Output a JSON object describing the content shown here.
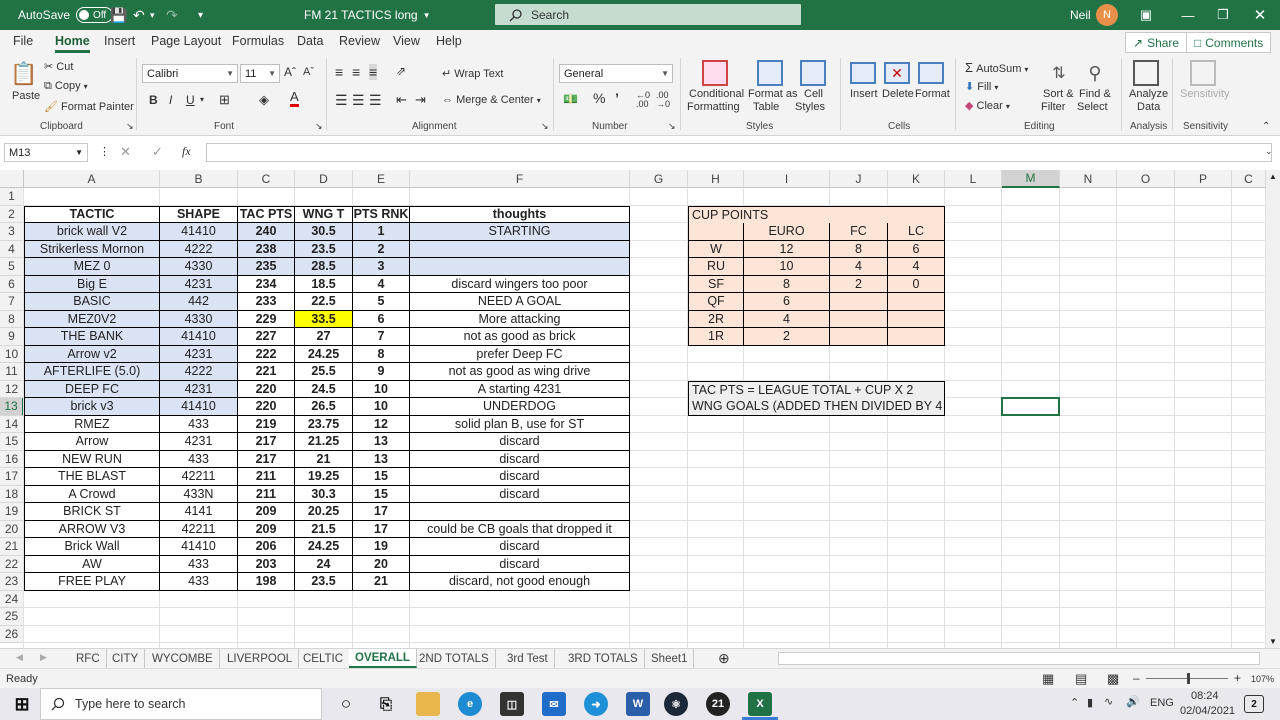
{
  "titlebar": {
    "autosave_label": "AutoSave",
    "autosave_state": "Off",
    "file_title": "FM 21 TACTICS long",
    "search_placeholder": "Search",
    "user_name": "Neil",
    "user_initial": "N"
  },
  "ribbon_tabs": [
    "File",
    "Home",
    "Insert",
    "Page Layout",
    "Formulas",
    "Data",
    "Review",
    "View",
    "Help"
  ],
  "active_tab": "Home",
  "share_label": "Share",
  "comments_label": "Comments",
  "ribbon": {
    "clipboard": {
      "paste": "Paste",
      "cut": "Cut",
      "copy": "Copy",
      "format_painter": "Format Painter",
      "label": "Clipboard"
    },
    "font": {
      "name": "Calibri",
      "size": "11",
      "label": "Font"
    },
    "alignment": {
      "wrap_text": "Wrap Text",
      "merge_center": "Merge & Center",
      "label": "Alignment"
    },
    "number": {
      "format": "General",
      "label": "Number"
    },
    "styles": {
      "conditional_1": "Conditional",
      "conditional_2": "Formatting",
      "format_as_1": "Format as",
      "format_as_2": "Table",
      "cell_1": "Cell",
      "cell_2": "Styles",
      "label": "Styles"
    },
    "cells": {
      "insert": "Insert",
      "delete": "Delete",
      "format": "Format",
      "label": "Cells"
    },
    "editing": {
      "autosum": "AutoSum",
      "fill": "Fill",
      "clear": "Clear",
      "sort_1": "Sort &",
      "sort_2": "Filter",
      "find_1": "Find &",
      "find_2": "Select",
      "label": "Editing"
    },
    "analysis": {
      "analyze_1": "Analyze",
      "analyze_2": "Data",
      "label": "Analysis"
    },
    "sensitivity": {
      "button": "Sensitivity",
      "label": "Sensitivity"
    }
  },
  "formula_bar": {
    "name_box": "M13",
    "fx": "fx",
    "content": ""
  },
  "columns": [
    "A",
    "B",
    "C",
    "D",
    "E",
    "F",
    "G",
    "H",
    "I",
    "J",
    "K",
    "L",
    "M",
    "N",
    "O",
    "P",
    "C"
  ],
  "rows": [
    "1",
    "2",
    "3",
    "4",
    "5",
    "6",
    "7",
    "8",
    "9",
    "10",
    "11",
    "12",
    "13",
    "14",
    "15",
    "16",
    "17",
    "18",
    "19",
    "20",
    "21",
    "22",
    "23",
    "24",
    "25",
    "26"
  ],
  "selected_cell": "M13",
  "main_table": {
    "headers": [
      "TACTIC",
      "SHAPE",
      "TAC PTS",
      "WNG T",
      "PTS RNK",
      "thoughts"
    ],
    "rows": [
      [
        "brick wall V2",
        "41410",
        "240",
        "30.5",
        "1",
        "STARTING"
      ],
      [
        "Strikerless Mornon",
        "4222",
        "238",
        "23.5",
        "2",
        ""
      ],
      [
        "MEZ 0",
        "4330",
        "235",
        "28.5",
        "3",
        ""
      ],
      [
        "Big E",
        "4231",
        "234",
        "18.5",
        "4",
        "discard wingers too poor"
      ],
      [
        "BASIC",
        "442",
        "233",
        "22.5",
        "5",
        "NEED A GOAL"
      ],
      [
        "MEZ0V2",
        "4330",
        "229",
        "33.5",
        "6",
        "More attacking"
      ],
      [
        "THE BANK",
        "41410",
        "227",
        "27",
        "7",
        "not as good as brick"
      ],
      [
        "Arrow v2",
        "4231",
        "222",
        "24.25",
        "8",
        "prefer Deep FC"
      ],
      [
        "AFTERLIFE (5.0)",
        "4222",
        "221",
        "25.5",
        "9",
        "not as good as wing drive"
      ],
      [
        "DEEP FC",
        "4231",
        "220",
        "24.5",
        "10",
        "A starting 4231"
      ],
      [
        "brick v3",
        "41410",
        "220",
        "26.5",
        "10",
        "UNDERDOG"
      ],
      [
        "RMEZ",
        "433",
        "219",
        "23.75",
        "12",
        "solid plan B, use for ST"
      ],
      [
        "Arrow",
        "4231",
        "217",
        "21.25",
        "13",
        "discard"
      ],
      [
        "NEW RUN",
        "433",
        "217",
        "21",
        "13",
        "discard"
      ],
      [
        "THE BLAST",
        "42211",
        "211",
        "19.25",
        "15",
        "discard"
      ],
      [
        "A Crowd",
        "433N",
        "211",
        "30.3",
        "15",
        "discard"
      ],
      [
        "BRICK ST",
        "4141",
        "209",
        "20.25",
        "17",
        ""
      ],
      [
        "ARROW V3",
        "42211",
        "209",
        "21.5",
        "17",
        "could be CB goals that dropped it"
      ],
      [
        "Brick Wall",
        "41410",
        "206",
        "24.25",
        "19",
        "discard"
      ],
      [
        "AW",
        "433",
        "203",
        "24",
        "20",
        "discard"
      ],
      [
        "FREE PLAY",
        "433",
        "198",
        "23.5",
        "21",
        "discard, not good enough"
      ]
    ]
  },
  "cup_points": {
    "title": "CUP POINTS",
    "headers": [
      "",
      "EURO",
      "FC",
      "LC"
    ],
    "rows": [
      [
        "W",
        "12",
        "8",
        "6"
      ],
      [
        "RU",
        "10",
        "4",
        "4"
      ],
      [
        "SF",
        "8",
        "2",
        "0"
      ],
      [
        "QF",
        "6",
        "",
        ""
      ],
      [
        "2R",
        "4",
        "",
        ""
      ],
      [
        "1R",
        "2",
        "",
        ""
      ]
    ]
  },
  "notes": [
    "TAC PTS = LEAGUE TOTAL + CUP X 2",
    "WNG GOALS (ADDED THEN DIVIDED BY 4"
  ],
  "sheet_tabs": [
    "RFC",
    "CITY",
    "WYCOMBE",
    "LIVERPOOL",
    "CELTIC",
    "OVERALL",
    "2ND TOTALS",
    "3rd Test",
    "3RD TOTALS",
    "Sheet1"
  ],
  "active_sheet": "OVERALL",
  "status": {
    "ready": "Ready",
    "zoom": "107%"
  },
  "taskbar": {
    "search_placeholder": "Type here to search",
    "lang": "ENG",
    "time": "08:24",
    "date": "02/04/2021",
    "notif_count": "2"
  },
  "colors": {
    "excel_green": "#217346",
    "table_fill": "#dae3f3",
    "cup_fill": "#fce4d6",
    "highlight": "#ffff00"
  }
}
